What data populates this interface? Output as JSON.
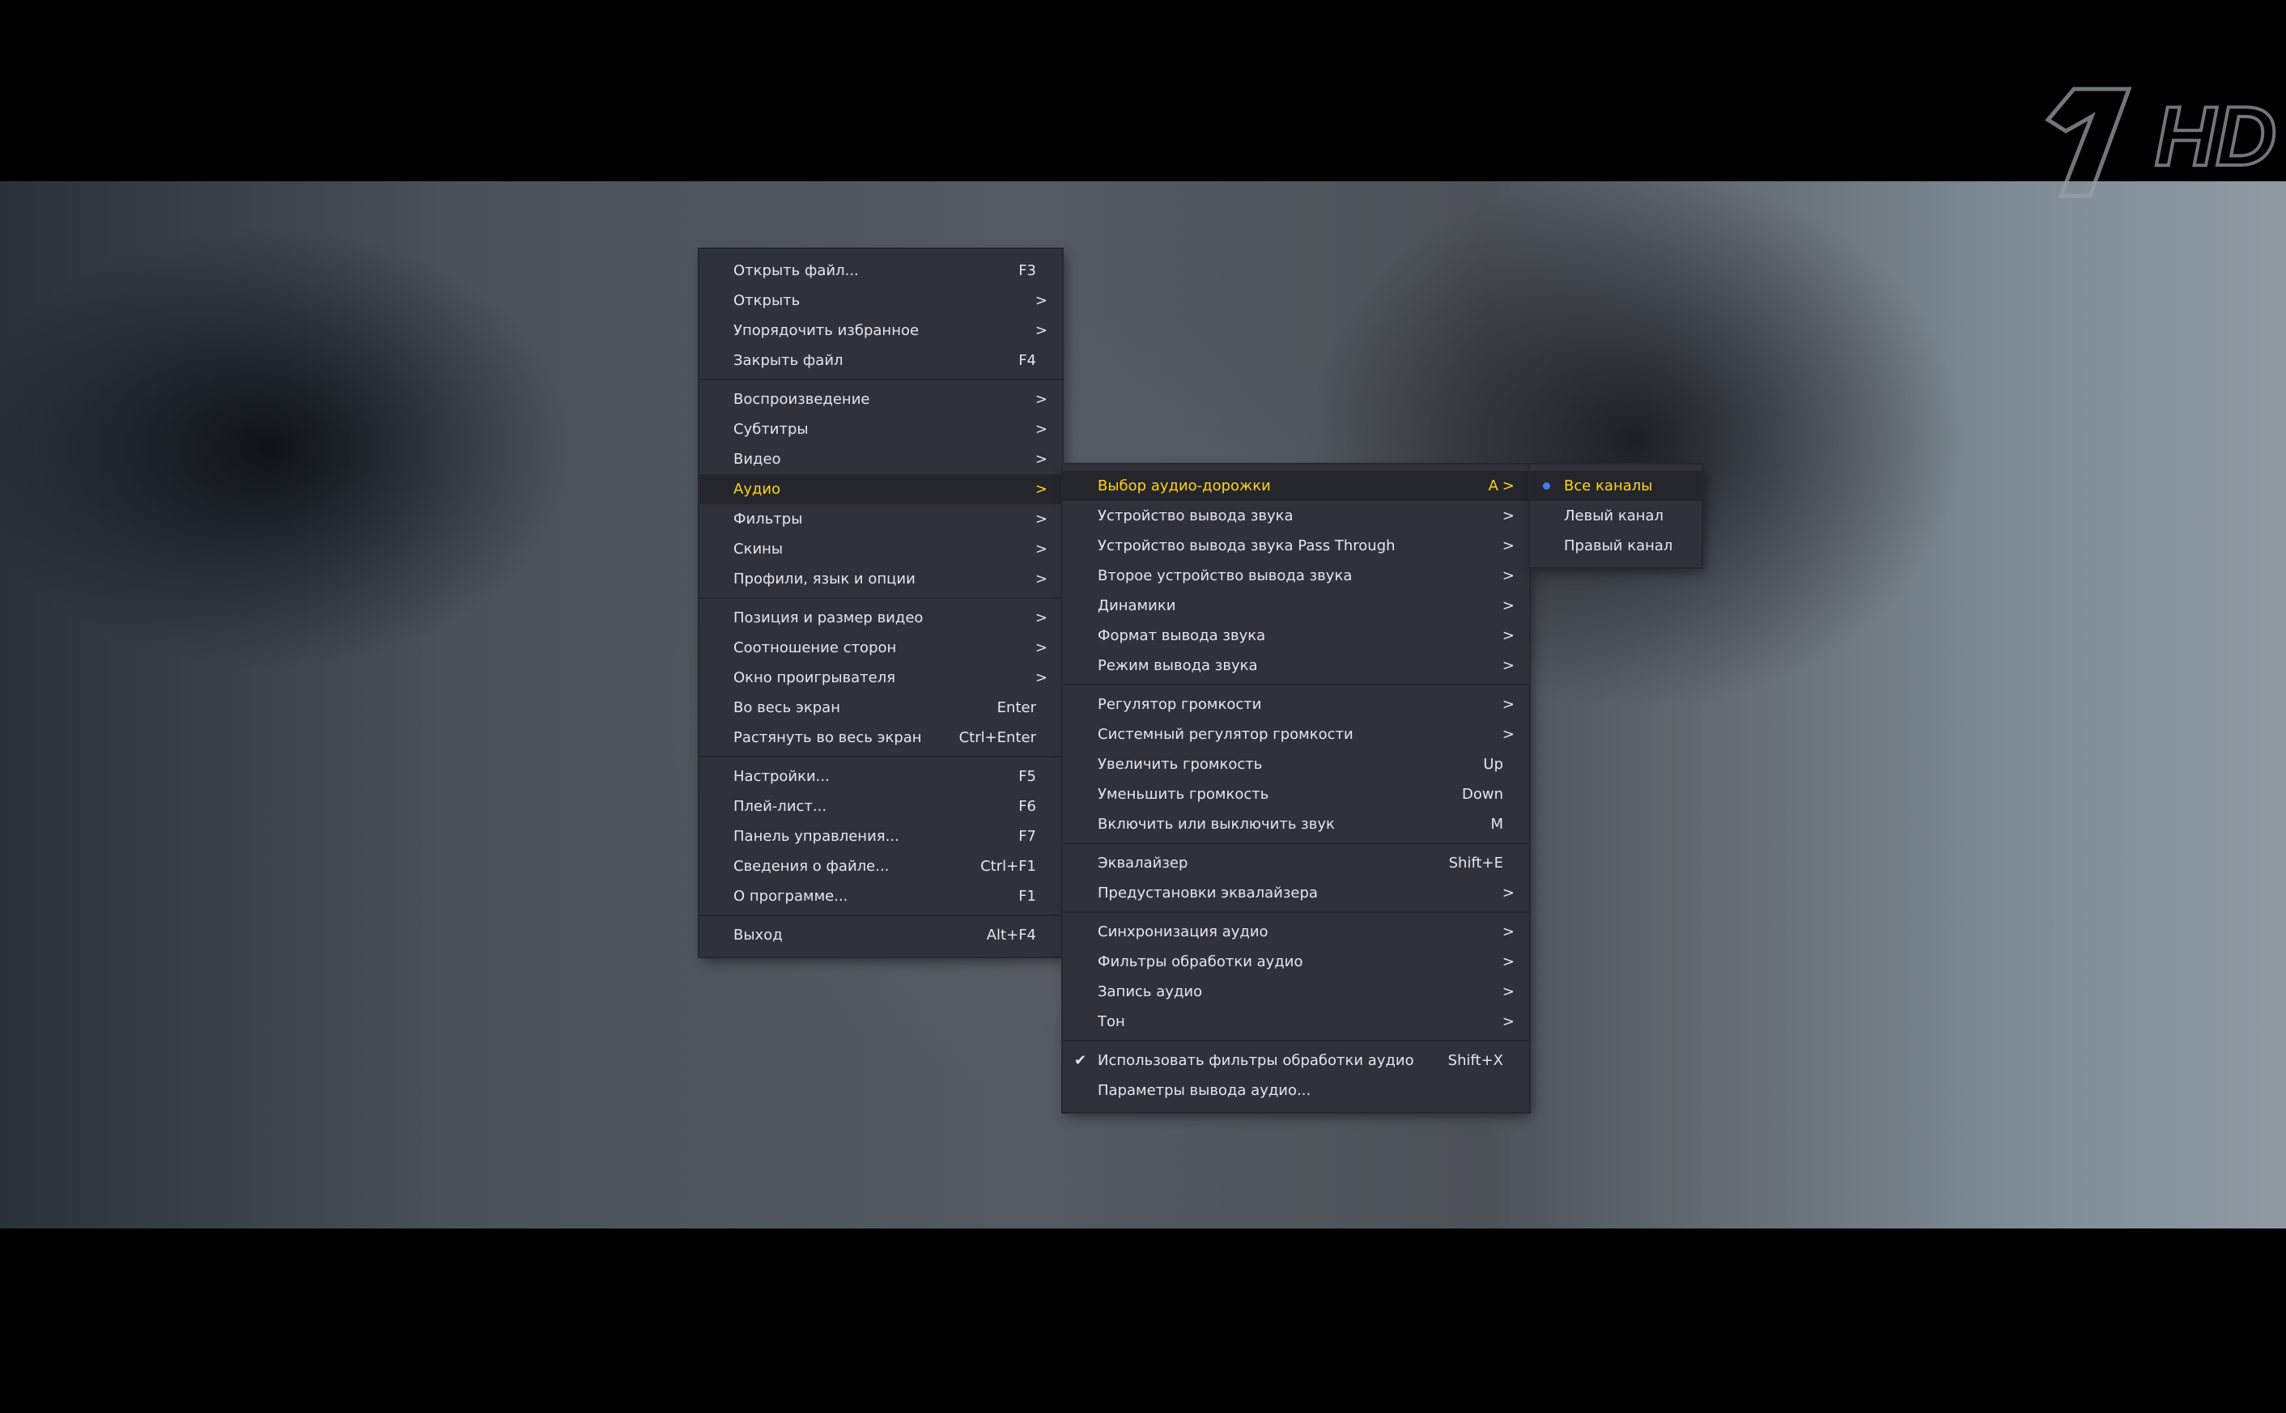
{
  "logo": {
    "text": "HD"
  },
  "main_menu": {
    "groups": [
      [
        {
          "label": "Открыть файл...",
          "shortcut": "F3",
          "arrow": ""
        },
        {
          "label": "Открыть",
          "shortcut": "",
          "arrow": ">"
        },
        {
          "label": "Упорядочить избранное",
          "shortcut": "",
          "arrow": ">"
        },
        {
          "label": "Закрыть файл",
          "shortcut": "F4",
          "arrow": ""
        }
      ],
      [
        {
          "label": "Воспроизведение",
          "shortcut": "",
          "arrow": ">"
        },
        {
          "label": "Субтитры",
          "shortcut": "",
          "arrow": ">"
        },
        {
          "label": "Видео",
          "shortcut": "",
          "arrow": ">"
        },
        {
          "label": "Аудио",
          "shortcut": "",
          "arrow": ">",
          "active": true
        },
        {
          "label": "Фильтры",
          "shortcut": "",
          "arrow": ">"
        },
        {
          "label": "Скины",
          "shortcut": "",
          "arrow": ">"
        },
        {
          "label": "Профили, язык и опции",
          "shortcut": "",
          "arrow": ">"
        }
      ],
      [
        {
          "label": "Позиция и размер видео",
          "shortcut": "",
          "arrow": ">"
        },
        {
          "label": "Соотношение сторон",
          "shortcut": "",
          "arrow": ">"
        },
        {
          "label": "Окно проигрывателя",
          "shortcut": "",
          "arrow": ">"
        },
        {
          "label": "Во весь экран",
          "shortcut": "Enter",
          "arrow": ""
        },
        {
          "label": "Растянуть во весь экран",
          "shortcut": "Ctrl+Enter",
          "arrow": ""
        }
      ],
      [
        {
          "label": "Настройки...",
          "shortcut": "F5",
          "arrow": ""
        },
        {
          "label": "Плей-лист...",
          "shortcut": "F6",
          "arrow": ""
        },
        {
          "label": "Панель управления...",
          "shortcut": "F7",
          "arrow": ""
        },
        {
          "label": "Сведения о файле...",
          "shortcut": "Ctrl+F1",
          "arrow": ""
        },
        {
          "label": "О программе...",
          "shortcut": "F1",
          "arrow": ""
        }
      ],
      [
        {
          "label": "Выход",
          "shortcut": "Alt+F4",
          "arrow": ""
        }
      ]
    ]
  },
  "audio_menu": {
    "groups": [
      [
        {
          "label": "Выбор аудио-дорожки",
          "shortcut": "A",
          "arrow": ">",
          "active": true
        },
        {
          "label": "Устройство вывода звука",
          "shortcut": "",
          "arrow": ">"
        },
        {
          "label": "Устройство вывода звука Pass Through",
          "shortcut": "",
          "arrow": ">"
        },
        {
          "label": "Второе устройство вывода звука",
          "shortcut": "",
          "arrow": ">"
        },
        {
          "label": "Динамики",
          "shortcut": "",
          "arrow": ">"
        },
        {
          "label": "Формат вывода звука",
          "shortcut": "",
          "arrow": ">"
        },
        {
          "label": "Режим вывода звука",
          "shortcut": "",
          "arrow": ">"
        }
      ],
      [
        {
          "label": "Регулятор громкости",
          "shortcut": "",
          "arrow": ">"
        },
        {
          "label": "Системный регулятор громкости",
          "shortcut": "",
          "arrow": ">"
        },
        {
          "label": "Увеличить громкость",
          "shortcut": "Up",
          "arrow": ""
        },
        {
          "label": "Уменьшить громкость",
          "shortcut": "Down",
          "arrow": ""
        },
        {
          "label": "Включить или выключить звук",
          "shortcut": "M",
          "arrow": ""
        }
      ],
      [
        {
          "label": "Эквалайзер",
          "shortcut": "Shift+E",
          "arrow": ""
        },
        {
          "label": "Предустановки эквалайзера",
          "shortcut": "",
          "arrow": ">"
        }
      ],
      [
        {
          "label": "Синхронизация аудио",
          "shortcut": "",
          "arrow": ">"
        },
        {
          "label": "Фильтры обработки аудио",
          "shortcut": "",
          "arrow": ">"
        },
        {
          "label": "Запись аудио",
          "shortcut": "",
          "arrow": ">"
        },
        {
          "label": "Тон",
          "shortcut": "",
          "arrow": ">"
        }
      ],
      [
        {
          "label": "Использовать фильтры обработки аудио",
          "shortcut": "Shift+X",
          "arrow": "",
          "checked": true
        },
        {
          "label": "Параметры вывода аудио...",
          "shortcut": "",
          "arrow": ""
        }
      ]
    ]
  },
  "track_menu": {
    "items": [
      {
        "label": "Все каналы",
        "selected": true,
        "active": true
      },
      {
        "label": "Левый канал",
        "selected": false
      },
      {
        "label": "Правый канал",
        "selected": false
      }
    ]
  },
  "colors": {
    "menu_bg": "#30323a",
    "highlight_text": "#ffd21e",
    "radio_dot": "#3d7ff0"
  }
}
